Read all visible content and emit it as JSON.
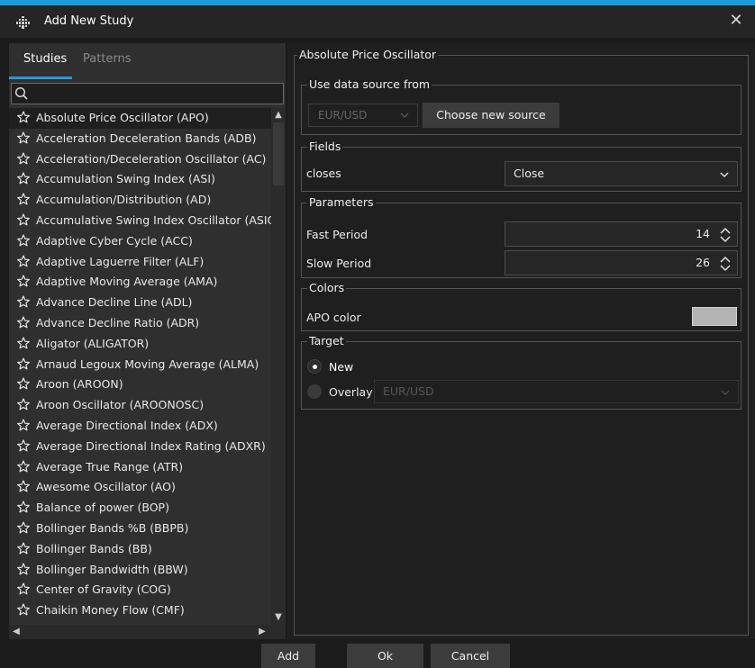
{
  "window": {
    "title": "Add New Study",
    "close_glyph": "✕"
  },
  "tabs": [
    {
      "label": "Studies",
      "active": true
    },
    {
      "label": "Patterns",
      "active": false
    }
  ],
  "search": {
    "value": "",
    "placeholder": ""
  },
  "studies": [
    "Absolute Price Oscillator (APO)",
    "Acceleration Deceleration Bands (ADB)",
    "Acceleration/Deceleration Oscillator (AC)",
    "Accumulation Swing Index (ASI)",
    "Accumulation/Distribution (AD)",
    "Accumulative Swing Index Oscillator (ASIO)",
    "Adaptive Cyber Cycle (ACC)",
    "Adaptive Laguerre Filter (ALF)",
    "Adaptive Moving Average (AMA)",
    "Advance Decline Line (ADL)",
    "Advance Decline Ratio (ADR)",
    "Aligator (ALIGATOR)",
    "Arnaud Legoux Moving Average (ALMA)",
    "Aroon (AROON)",
    "Aroon Oscillator (AROONOSC)",
    "Average Directional Index (ADX)",
    "Average Directional Index Rating (ADXR)",
    "Average True Range (ATR)",
    "Awesome Oscillator (AO)",
    "Balance of power (BOP)",
    "Bollinger Bands %B (BBPB)",
    "Bollinger Bands (BB)",
    "Bollinger Bandwidth (BBW)",
    "Center of Gravity (COG)",
    "Chaikin Money Flow (CMF)"
  ],
  "selected_index": 0,
  "details": {
    "title": "Absolute Price Oscillator",
    "data_source": {
      "legend": "Use data source from",
      "source_value": "EUR/USD",
      "choose_button": "Choose new source"
    },
    "fields": {
      "legend": "Fields",
      "label": "closes",
      "value": "Close"
    },
    "parameters": {
      "legend": "Parameters",
      "fast_label": "Fast Period",
      "fast_value": "14",
      "slow_label": "Slow Period",
      "slow_value": "26"
    },
    "colors": {
      "legend": "Colors",
      "label": "APO color",
      "swatch_color": "#b4b4b4"
    },
    "target": {
      "legend": "Target",
      "new_label": "New",
      "new_selected": true,
      "overlay_label": "Overlay",
      "overlay_value": "EUR/USD"
    }
  },
  "footer": {
    "add": "Add",
    "ok": "Ok",
    "cancel": "Cancel"
  },
  "colors": {
    "accent": "#1d9bd6",
    "tab_underline": "#1e9ae0",
    "window_bg": "#1b1b1b"
  }
}
